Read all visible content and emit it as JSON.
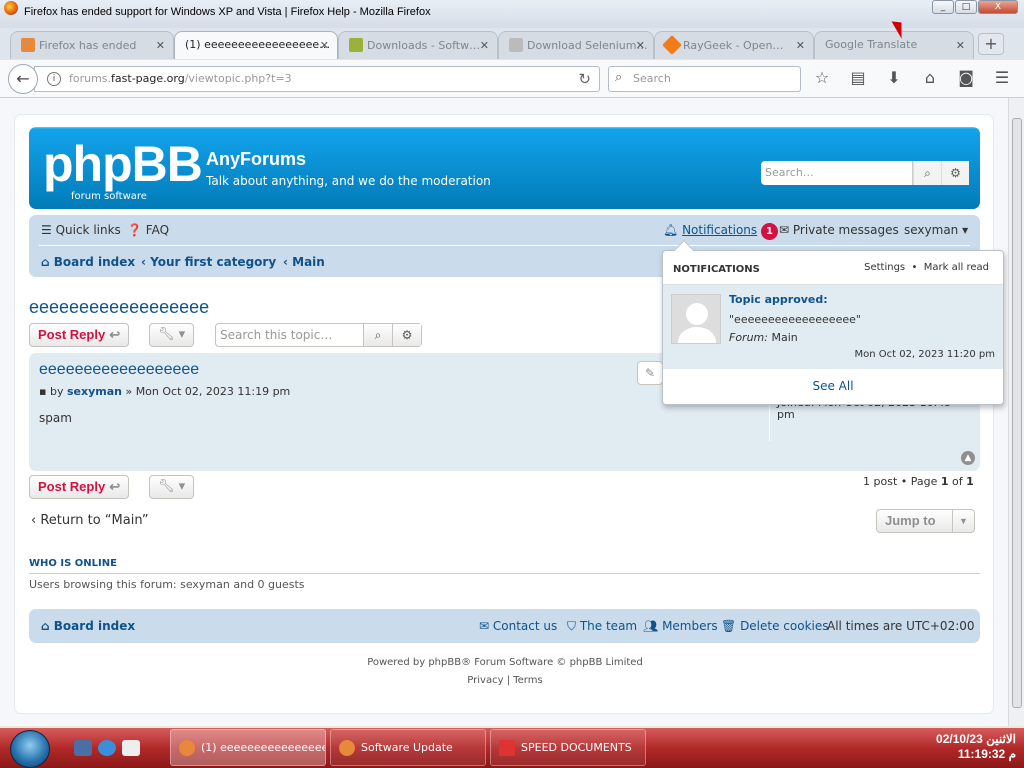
{
  "window": {
    "title": "Firefox has ended support for Windows XP and Vista | Firefox Help - Mozilla Firefox",
    "min": "_",
    "max": "□",
    "close": "X"
  },
  "tabs": [
    {
      "label": "Firefox has ended",
      "active": false
    },
    {
      "label": "(1) eeeeeeeeeeeeeeeee…",
      "active": true
    },
    {
      "label": "Downloads - Softw…",
      "active": false
    },
    {
      "label": "Download Selenium…",
      "active": false
    },
    {
      "label": "RayGeek - Open…",
      "active": false
    },
    {
      "label": "Google Translate",
      "active": false
    }
  ],
  "newtab": "+",
  "nav": {
    "url_host": "forums.",
    "url_domain": "fast-page.org",
    "url_path": "/viewtopic.php?t=3",
    "search_placeholder": "Search"
  },
  "header": {
    "logo": "phpBB",
    "logo_sub": "forum   software",
    "site_name": "AnyForums",
    "site_desc": "Talk about anything, and we do the moderation",
    "search_placeholder": "Search…"
  },
  "navbar": {
    "quick_links": "Quick links",
    "faq": "FAQ",
    "notifications": "Notifications",
    "notif_count": "1",
    "pm": "Private messages",
    "user": "sexyman"
  },
  "breadcrumb": {
    "index": "Board index",
    "category": "Your first category",
    "forum": "Main"
  },
  "topic": {
    "title": "eeeeeeeeeeeeeeeeee",
    "post_reply": "Post Reply",
    "search_placeholder": "Search this topic…"
  },
  "post": {
    "title": "eeeeeeeeeeeeeeeeee",
    "by": "by",
    "author": "sexyman",
    "date": "» Mon Oct 02, 2023 11:19 pm",
    "content": "spam",
    "ghost_joined": "Joined: Mon Oct 02, 2023 10:45",
    "ghost_pm": "pm"
  },
  "pagination": {
    "text": "1 post • Page",
    "page": "1",
    "of": "of",
    "total": "1"
  },
  "return_text": "Return to “Main”",
  "jump": "Jump to",
  "who": {
    "title": "WHO IS ONLINE",
    "text": "Users browsing this forum: sexyman and 0 guests"
  },
  "footer": {
    "index": "Board index",
    "contact": "Contact us",
    "team": "The team",
    "members": "Members",
    "delete": "Delete cookies",
    "tz": "All times are UTC+02:00",
    "powered": "Powered by phpBB® Forum Software © phpBB Limited",
    "privacy": "Privacy",
    "sep": "|",
    "terms": "Terms"
  },
  "notifications": {
    "header": "NOTIFICATIONS",
    "settings": "Settings",
    "dot": "•",
    "mark": "Mark all read",
    "t1": "Topic approved:",
    "t2": "\"eeeeeeeeeeeeeeeeee\"",
    "forum_label": "Forum:",
    "forum": "Main",
    "date": "Mon Oct 02, 2023 11:20 pm",
    "see_all": "See All"
  },
  "taskbar": {
    "items": [
      "(1) eeeeeeeeeeeeeeee...",
      "Software Update",
      "SPEED DOCUMENTS"
    ],
    "date": "الاثنين 02/10/23",
    "time": "11:19:32 م"
  },
  "colors": {
    "brand": "#105289",
    "header": "#0076b1",
    "red": "#d31141"
  }
}
